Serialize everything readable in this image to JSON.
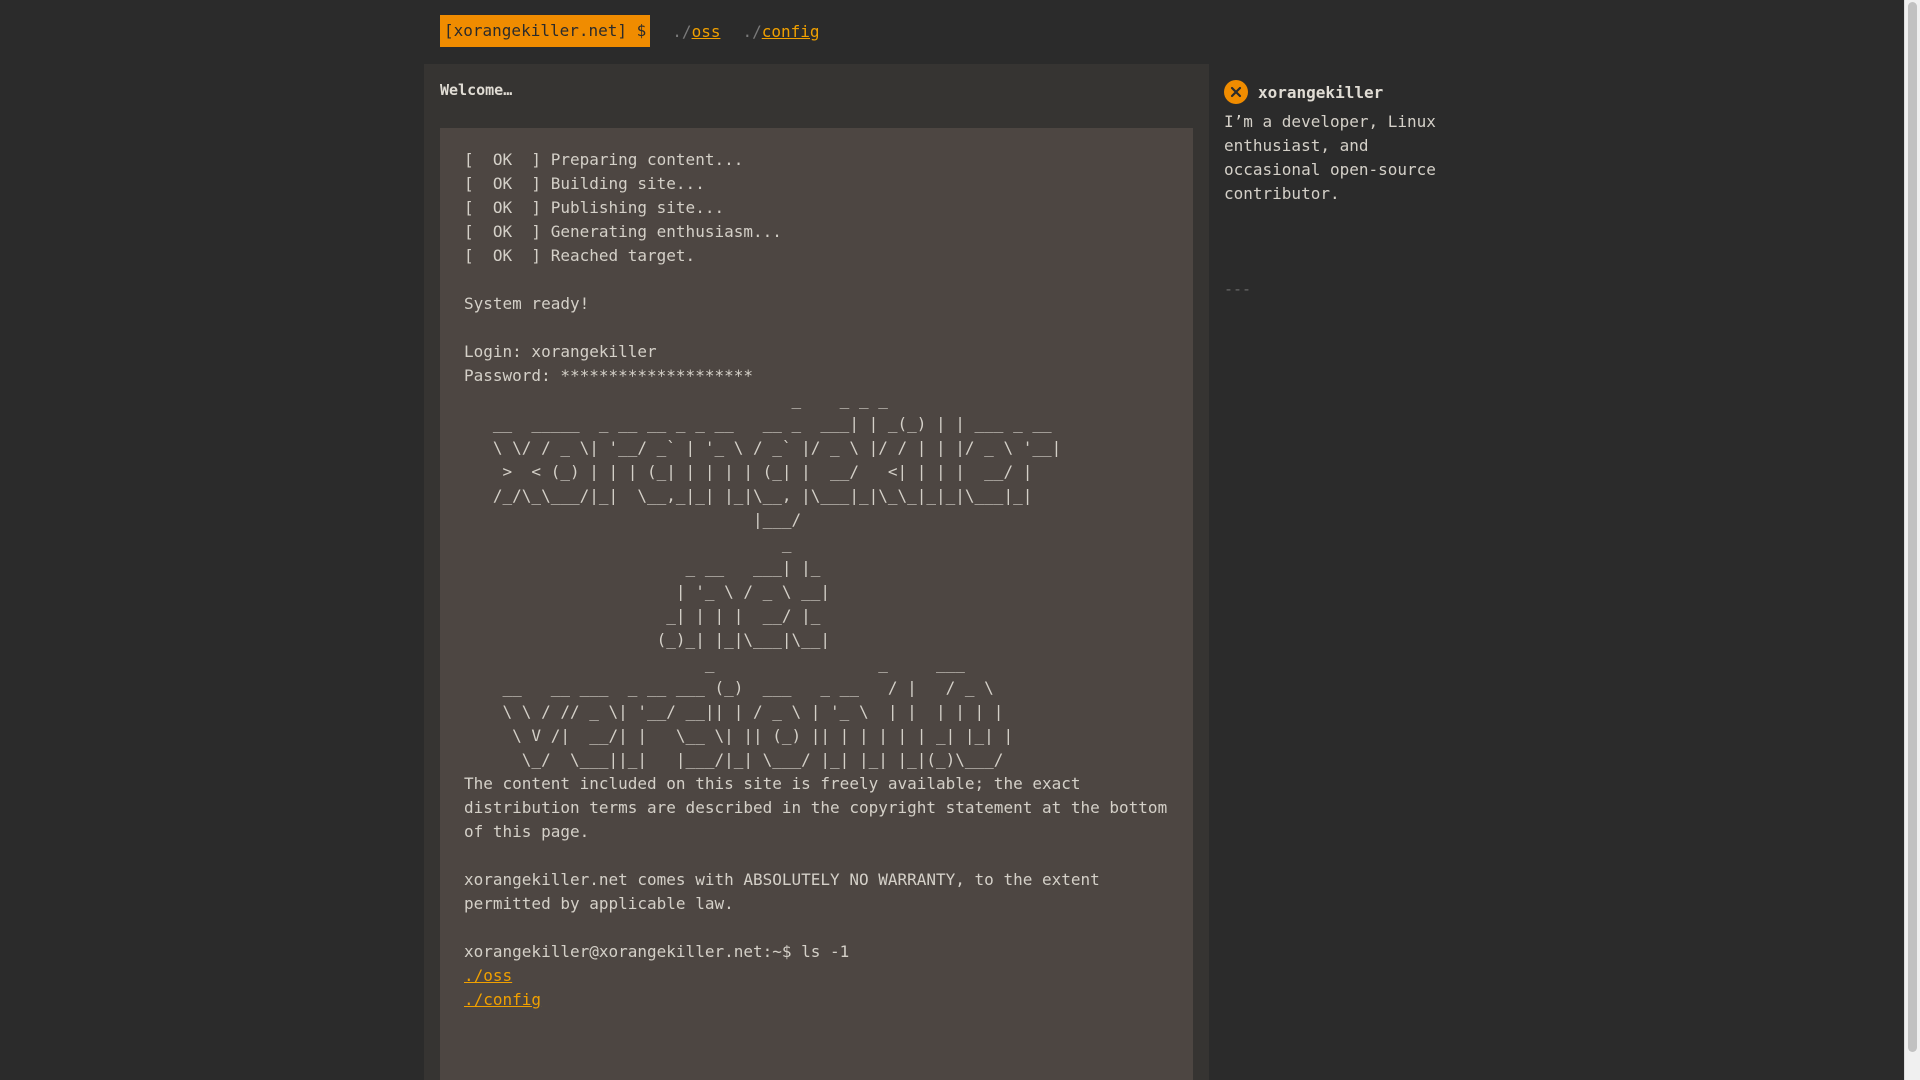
{
  "nav": {
    "brand": "[xorangekiller.net] $",
    "links": [
      {
        "prefix": "./",
        "label": "oss"
      },
      {
        "prefix": "./",
        "label": "config"
      }
    ]
  },
  "main": {
    "heading": "Welcome…",
    "boot_lines": [
      "[  OK  ] Preparing content...",
      "[  OK  ] Building site...",
      "[  OK  ] Publishing site...",
      "[  OK  ] Generating enthusiasm...",
      "[  OK  ] Reached target."
    ],
    "system_ready": "System ready!",
    "login_line": "Login: xorangekiller",
    "password_line": "Password: ********************",
    "ascii_art": "                                  _    _ _ _\n   __  _____  _ __ __ _ _ __   __ _  ___| | _(_) | | ___ _ __\n   \\ \\/ / _ \\| '__/ _` | '_ \\ / _` |/ _ \\ |/ / | | |/ _ \\ '__|\n    >  < (_) | | | (_| | | | | (_| |  __/   <| | | |  __/ |\n   /_/\\_\\___/|_|  \\__,_|_| |_|\\__, |\\___|_|\\_\\_|_|_|\\___|_|\n                              |___/\n                                 _\n                       _ __   ___| |_\n                      | '_ \\ / _ \\ __|\n                     _| | | |  __/ |_\n                    (_)_| |_|\\___|\\__|\n                         _                 _     ___\n    __   __ ___  _ __ ___ (_)  ___   _ __   / |   / _ \\\n    \\ \\ / // _ \\| '__/ __|| | / _ \\ | '_ \\  | |  | | | |\n     \\ V /|  __/| |   \\__ \\| || (_) || | | | | | _| |_| |\n      \\_/  \\___||_|   |___/|_| \\___/ |_| |_| |_|(_)\\___/",
    "license_text": "The content included on this site is freely available; the exact distribution terms are described in the copyright statement at the bottom of this page.",
    "warranty_text": "xorangekiller.net comes with ABSOLUTELY NO WARRANTY, to the extent permitted by applicable law.",
    "prompt_line": "xorangekiller@xorangekiller.net:~$ ls -1",
    "ls_links": [
      "./oss",
      "./config"
    ]
  },
  "sidebar": {
    "name": "xorangekiller",
    "bio": "I’m a developer, Linux enthusiast, and occasional open-source contributor.",
    "divider": "---"
  },
  "colors": {
    "accent": "#f08c00",
    "background": "#2b2b2b",
    "panel": "#363432",
    "terminal": "#4d4642"
  }
}
